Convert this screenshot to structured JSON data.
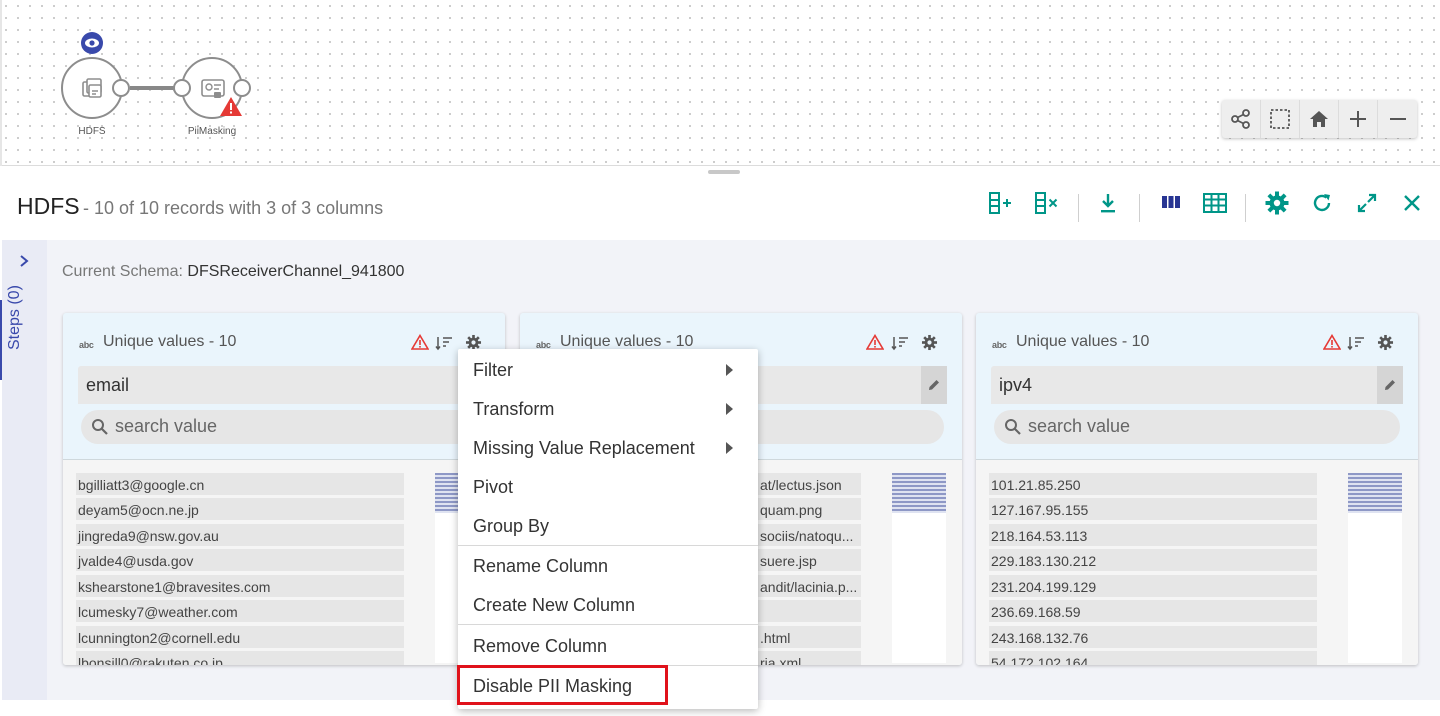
{
  "pipeline": {
    "nodes": [
      {
        "label": "HDFS"
      },
      {
        "label": "PiiMasking"
      }
    ]
  },
  "canvas_tools": [
    "layout-icon",
    "select-area-icon",
    "home-icon",
    "zoom-in-icon",
    "zoom-out-icon"
  ],
  "header": {
    "title": "HDFS",
    "subtitle": "- 10 of 10 records with 3 of 3 columns"
  },
  "toolbar": [
    "add-column-icon",
    "remove-column-icon",
    "download-icon",
    "columns-view-icon",
    "table-view-icon",
    "settings-icon",
    "refresh-icon",
    "expand-icon",
    "close-icon"
  ],
  "steps": {
    "label": "Steps (0)"
  },
  "schema": {
    "label": "Current Schema:",
    "name": "DFSReceiverChannel_941800"
  },
  "cards": [
    {
      "type_badge": "abc",
      "unique_label": "Unique values - 10",
      "column": "email",
      "search_placeholder": "search value",
      "values": [
        "bgilliatt3@google.cn",
        "deyam5@ocn.ne.jp",
        "jingreda9@nsw.gov.au",
        "jvalde4@usda.gov",
        "kshearstone1@bravesites.com",
        "lcumesky7@weather.com",
        "lcunnington2@cornell.edu",
        "lbonsill0@rakuten.co.jp"
      ]
    },
    {
      "type_badge": "abc",
      "unique_label": "Unique values - 10",
      "column": "",
      "search_placeholder": "",
      "values": [
        "at/lectus.json",
        "quam.png",
        "sociis/natoqu...",
        "suere.jsp",
        "andit/lacinia.p...",
        "",
        ".html",
        "ria.xml"
      ]
    },
    {
      "type_badge": "abc",
      "unique_label": "Unique values - 10",
      "column": "ipv4",
      "search_placeholder": "search value",
      "values": [
        "101.21.85.250",
        "127.167.95.155",
        "218.164.53.113",
        "229.183.130.212",
        "231.204.199.129",
        "236.69.168.59",
        "243.168.132.76",
        "54.172.102.164"
      ]
    }
  ],
  "context_menu": {
    "items": [
      {
        "label": "Filter",
        "submenu": true
      },
      {
        "label": "Transform",
        "submenu": true
      },
      {
        "label": "Missing Value Replacement",
        "submenu": true
      },
      {
        "label": "Pivot",
        "submenu": false
      },
      {
        "label": "Group By",
        "submenu": false
      },
      {
        "label": "Rename Column",
        "submenu": false
      },
      {
        "label": "Create New Column",
        "submenu": false
      },
      {
        "label": "Remove Column",
        "submenu": false
      },
      {
        "label": "Disable PII Masking",
        "submenu": false,
        "highlighted": true
      }
    ]
  },
  "colors": {
    "accent": "#009688",
    "indigo": "#3949ab",
    "warning": "#e53935",
    "highlight": "#e0121b"
  }
}
